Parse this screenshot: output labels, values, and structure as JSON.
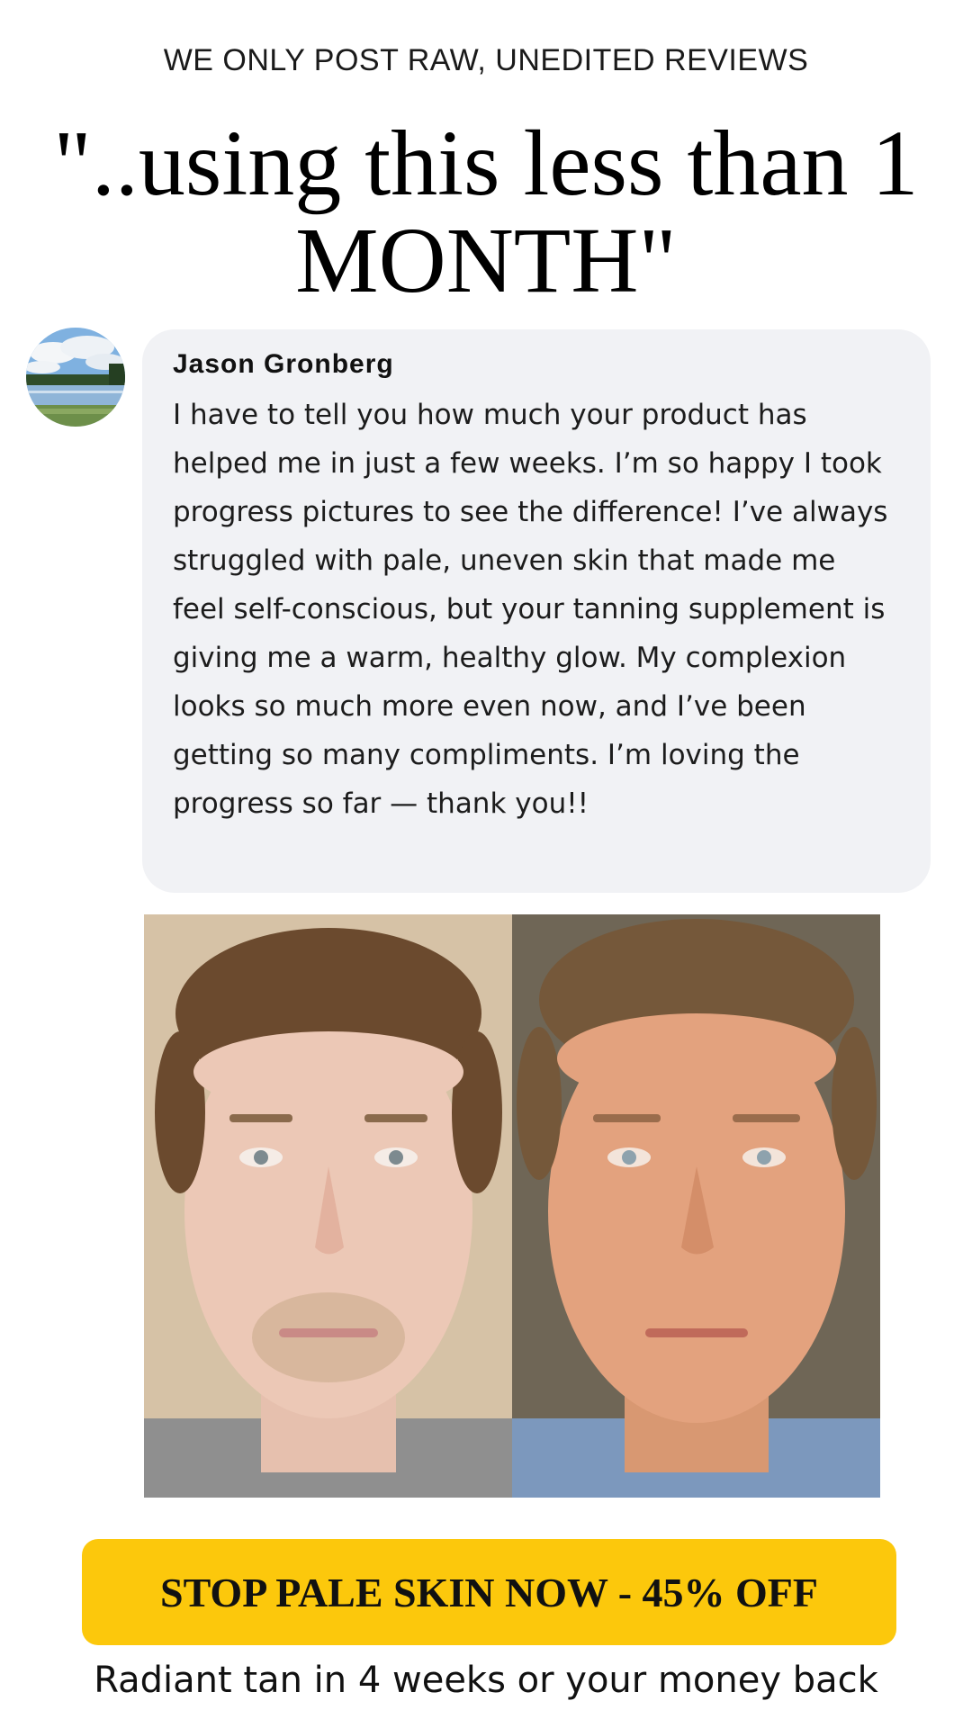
{
  "eyebrow": "WE ONLY POST RAW, UNEDITED REVIEWS",
  "headline": "\"..using this less than 1 MONTH\"",
  "review": {
    "avatar_icon": "lake-landscape-avatar",
    "name": "Jason Gronberg",
    "text": "I have to tell you how much your product has helped me in just a few weeks. I’m so happy I took progress pictures to see the difference! I’ve always struggled with pale, uneven skin that made me feel self-conscious, but your tanning supplement is giving me a warm, healthy glow. My complexion looks so much more even now, and I’ve been getting so many compliments. I’m loving the progress so far — thank you!!"
  },
  "cta": {
    "label": "STOP PALE SKIN NOW - 45% OFF",
    "color": "#fcc80c"
  },
  "guarantee": "Radiant tan in 4 weeks or your money back"
}
